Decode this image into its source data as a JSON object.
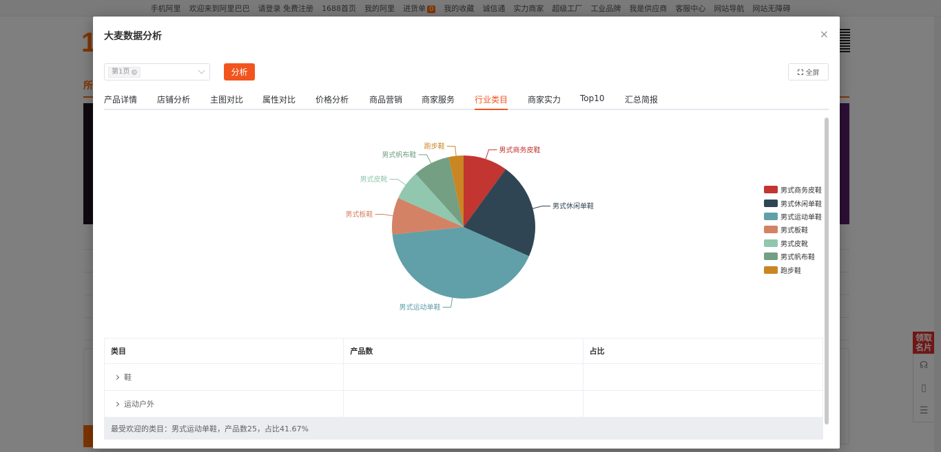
{
  "background": {
    "topbar": [
      "手机阿里",
      "欢迎来到阿里巴巴",
      "请登录 免费注册",
      "1688首页",
      "我的阿里",
      "进货单",
      "我的收藏",
      "诚信通",
      "实力商家",
      "超级工厂",
      "工业品牌",
      "我是供应商",
      "客服中心",
      "网站导航",
      "网站无障碍"
    ],
    "cart_count": "0",
    "logo": "1",
    "nav_text": "所",
    "side_button": "领取名片"
  },
  "modal": {
    "title": "大麦数据分析",
    "close_label": "×",
    "select_tag": "第1页",
    "analyze_label": "分析",
    "fullscreen_label": "全屏",
    "tabs": [
      "产品详情",
      "店铺分析",
      "主图对比",
      "属性对比",
      "价格分析",
      "商品营销",
      "商家服务",
      "行业类目",
      "商家实力",
      "Top10",
      "汇总简报"
    ],
    "active_tab": "行业类目"
  },
  "chart_data": {
    "type": "pie",
    "categories": [
      "男式商务皮鞋",
      "男式休闲单鞋",
      "男式运动单鞋",
      "男式板鞋",
      "男式皮靴",
      "男式帆布鞋",
      "跑步鞋"
    ],
    "values": [
      6,
      13,
      25,
      5,
      4,
      5,
      2
    ],
    "colors": [
      "#c23531",
      "#2f4554",
      "#61a0a8",
      "#d48265",
      "#91c7ae",
      "#749f83",
      "#ca8622"
    ],
    "legend_position": "right"
  },
  "table": {
    "headers": [
      "类目",
      "产品数",
      "占比"
    ],
    "rows": [
      {
        "name": "鞋",
        "count": "",
        "ratio": ""
      },
      {
        "name": "运动户外",
        "count": "",
        "ratio": ""
      }
    ],
    "summary": "最受欢迎的类目：男式运动单鞋，产品数25，占比41.67%"
  }
}
